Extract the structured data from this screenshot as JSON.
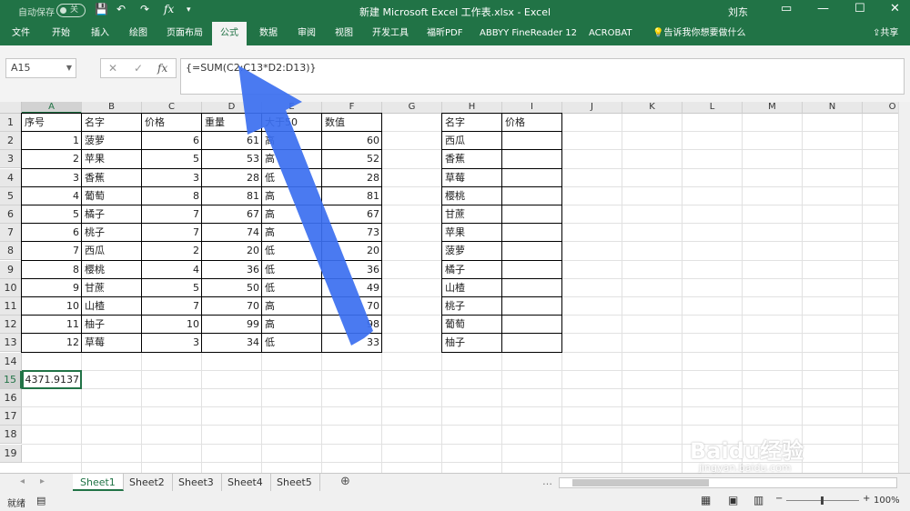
{
  "titlebar": {
    "autosave_label": "自动保存",
    "autosave_state": "关",
    "qat": {
      "save": "💾",
      "undo": "↶",
      "redo": "↷",
      "fx": "fx",
      "more": "▾"
    },
    "window_title": "新建 Microsoft Excel 工作表.xlsx  -  Excel",
    "user": "刘东",
    "controls": {
      "ribbon_display": "▭",
      "minimize": "—",
      "maximize": "☐",
      "close": "✕"
    }
  },
  "ribbon": {
    "tabs": [
      "文件",
      "开始",
      "插入",
      "绘图",
      "页面布局",
      "公式",
      "数据",
      "审阅",
      "视图",
      "开发工具",
      "福昕PDF",
      "ABBYY FineReader 12",
      "ACROBAT"
    ],
    "tell_me": "告诉我你想要做什么",
    "share": "共享"
  },
  "formula_bar": {
    "name_box": "A15",
    "cancel": "✕",
    "enter": "✓",
    "fx": "fx",
    "formula": "{=SUM(C2:C13*D2:D13)}"
  },
  "grid": {
    "columns": [
      "A",
      "B",
      "C",
      "D",
      "E",
      "F",
      "G",
      "H",
      "I",
      "J",
      "K",
      "L",
      "M",
      "N",
      "O"
    ],
    "rows": [
      "1",
      "2",
      "3",
      "4",
      "5",
      "6",
      "7",
      "8",
      "9",
      "10",
      "11",
      "12",
      "13",
      "14",
      "15",
      "16",
      "17",
      "18",
      "19"
    ],
    "table1": {
      "headers": [
        "序号",
        "名字",
        "价格",
        "重量",
        "大于50",
        "数值"
      ],
      "rows": [
        [
          "1",
          "菠萝",
          "6",
          "61",
          "高",
          "60"
        ],
        [
          "2",
          "苹果",
          "5",
          "53",
          "高",
          "52"
        ],
        [
          "3",
          "香蕉",
          "3",
          "28",
          "低",
          "28"
        ],
        [
          "4",
          "葡萄",
          "8",
          "81",
          "高",
          "81"
        ],
        [
          "5",
          "橘子",
          "7",
          "67",
          "高",
          "67"
        ],
        [
          "6",
          "桃子",
          "7",
          "74",
          "高",
          "73"
        ],
        [
          "7",
          "西瓜",
          "2",
          "20",
          "低",
          "20"
        ],
        [
          "8",
          "樱桃",
          "4",
          "36",
          "低",
          "36"
        ],
        [
          "9",
          "甘蔗",
          "5",
          "50",
          "低",
          "49"
        ],
        [
          "10",
          "山楂",
          "7",
          "70",
          "高",
          "70"
        ],
        [
          "11",
          "柚子",
          "10",
          "99",
          "高",
          "98"
        ],
        [
          "12",
          "草莓",
          "3",
          "34",
          "低",
          "33"
        ]
      ]
    },
    "table2": {
      "headers": [
        "名字",
        "价格"
      ],
      "rows": [
        "西瓜",
        "香蕉",
        "草莓",
        "樱桃",
        "甘蔗",
        "苹果",
        "菠萝",
        "橘子",
        "山楂",
        "桃子",
        "葡萄",
        "柚子"
      ]
    },
    "result_cell": "4371.9137"
  },
  "sheets": {
    "tabs": [
      "Sheet1",
      "Sheet2",
      "Sheet3",
      "Sheet4",
      "Sheet5"
    ],
    "active": 0,
    "add": "⊕",
    "nav_prev": "◂",
    "nav_next": "▸",
    "more": "…"
  },
  "status": {
    "ready": "就绪",
    "zoom": "100%",
    "zoom_minus": "−",
    "zoom_plus": "+"
  },
  "watermark": {
    "brand": "Baidu经验",
    "url": "jingyan.baidu.com"
  },
  "colors": {
    "excel_green": "#217346",
    "arrow_blue": "#3b6ff0"
  }
}
